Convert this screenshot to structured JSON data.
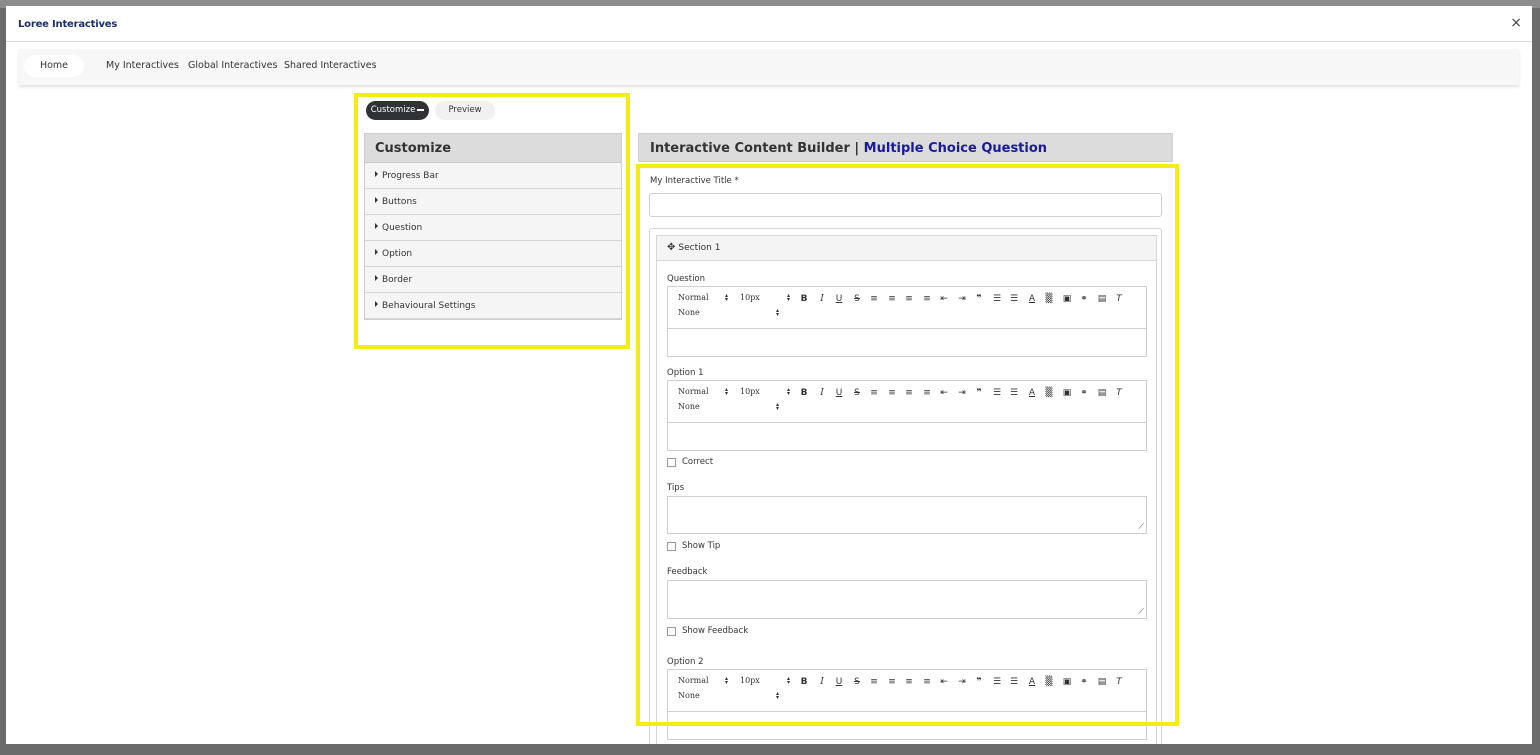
{
  "modal": {
    "title": "Loree Interactives",
    "close": "×"
  },
  "nav": {
    "items": [
      "Home",
      "My Interactives",
      "Global Interactives",
      "Shared Interactives"
    ]
  },
  "mode_tabs": {
    "customize": "Customize",
    "preview": "Preview"
  },
  "customize": {
    "title": "Customize",
    "items": [
      "Progress Bar",
      "Buttons",
      "Question",
      "Option",
      "Border",
      "Behavioural Settings"
    ]
  },
  "builder": {
    "title": "Interactive Content Builder |",
    "subtitle": "Multiple Choice Question",
    "title_field_label": "My Interactive Title *",
    "section_label": "Section 1",
    "question_label": "Question",
    "option1_label": "Option 1",
    "correct_label": "Correct",
    "tips_label": "Tips",
    "show_tip_label": "Show Tip",
    "feedback_label": "Feedback",
    "show_feedback_label": "Show Feedback",
    "option2_label": "Option 2"
  },
  "editor_toolbar": {
    "format": "Normal",
    "size": "10px",
    "font": "None"
  },
  "highlight_color": "#f4ec14"
}
